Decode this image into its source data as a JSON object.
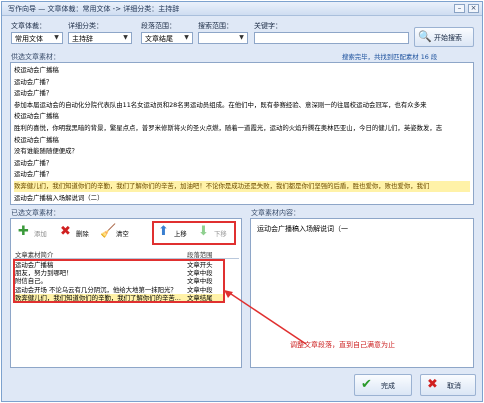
{
  "window": {
    "title": "写作向导 — 文章体裁：常用文体 -> 详细分类：主持辞",
    "min_glyph": "–",
    "close_glyph": "×"
  },
  "filters": {
    "genre_label": "文章体裁：",
    "genre_value": "常用文体",
    "category_label": "详细分类：",
    "category_value": "主持辞",
    "section_label": "段落范围：",
    "section_value": "文章结尾",
    "search_scope_label": "搜索范围：",
    "search_scope_value": "",
    "keyword_label": "关键字：",
    "keyword_value": "",
    "search_button": "开始搜索"
  },
  "source_panel": {
    "header": "供选文章素材：",
    "status": "搜索完毕，共找到匹配素材 16 段",
    "lines": [
      "校运动会广播稿",
      "运动会广播？",
      "运动会广播？",
      "参加本届运动会的自动化分院代表队由11名女运动员和28名男运动员组成。在他们中，既有参赛经验、意深刚一的往届校运动会冠军，也有众多来",
      "校运动会广播稿",
      "胜利的喜悦，你明我黑暗的背景，繁星点点，普罗米修斯将火的圣火点燃，随着一道霞光，运动的火焰升腾在奥林匹亚山，今日的健儿们，英姿数发，志",
      "校运动会广播稿",
      "没有谁能随随便便成？",
      "运动会广播？",
      "运动会广播？",
      "致奔健儿们，我们知道你们的辛勤，我们了解你们的辛苦，加油吧！不论你是成功还是失败，我们都是你们坚强的后盾，胜也爱你，败也爱你，我们",
      "运动会广播稿入场解说词（二）"
    ],
    "highlight_index": 10
  },
  "selected_panel": {
    "header": "已选文章素材：",
    "toolbar": {
      "add": "添加",
      "delete": "删除",
      "clear": "清空",
      "up": "上移",
      "down": "下移"
    },
    "columns": {
      "name": "文章素材简介",
      "type": "段落范围"
    },
    "rows": [
      {
        "name": "运动会广播稿",
        "type": "文章开头"
      },
      {
        "name": "朋友，努力到哪吧！",
        "type": "文章中段"
      },
      {
        "name": "附信自己。",
        "type": "文章中段"
      },
      {
        "name": "运动会开场 不论乌云有几分阴沉，他给大地第一抹阳光？",
        "type": "文章中段"
      },
      {
        "name": "致奔健儿们，我们知道你们的辛勤，我们了解你们的辛苦...",
        "type": "文章结尾"
      }
    ],
    "highlight_row": 4
  },
  "content_panel": {
    "header": "文章素材内容：",
    "text": "运动会广播稿入场解说词（一"
  },
  "annotation": "调整文章段落，直到自己满意为止",
  "footer": {
    "finish": "完成",
    "cancel": "取消"
  },
  "colors": {
    "accent": "#1a4f9c",
    "highlight": "#fff2a8",
    "annotation": "#e03030"
  }
}
